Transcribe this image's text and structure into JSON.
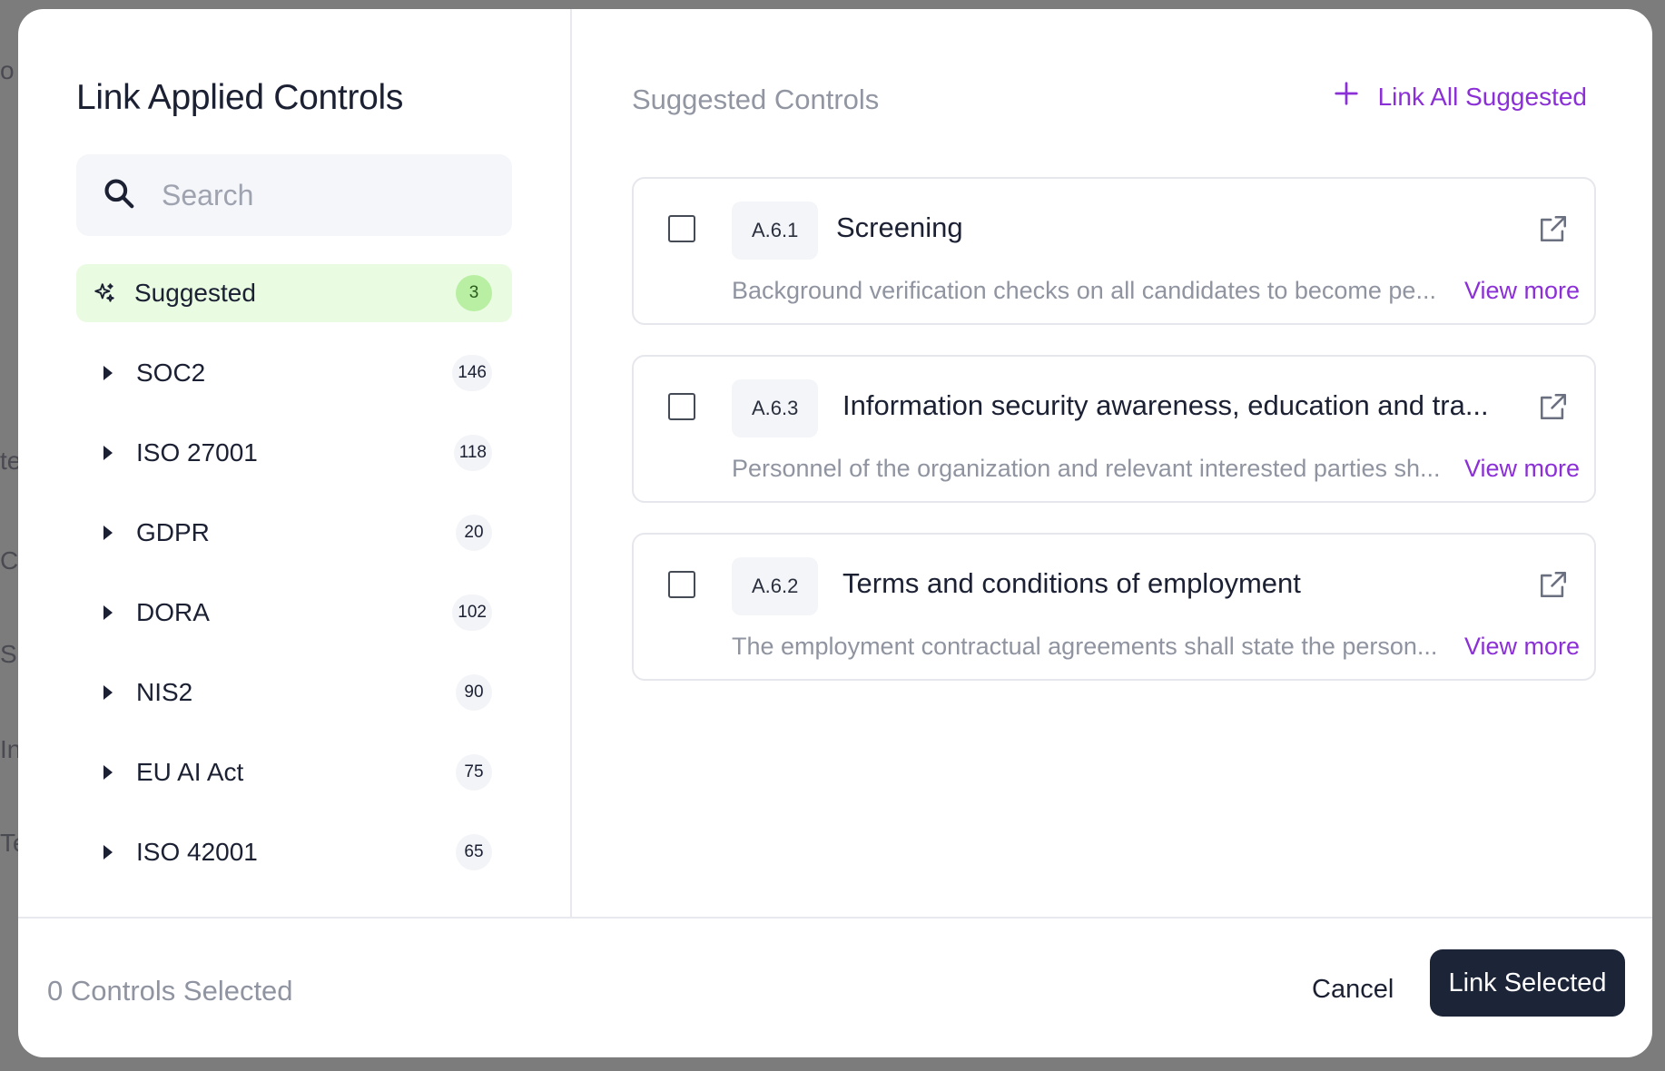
{
  "modal": {
    "title": "Link Applied Controls",
    "search": {
      "placeholder": "Search",
      "value": ""
    },
    "nav": [
      {
        "label": "Suggested",
        "count": "3",
        "active": true,
        "icon": "sparkles-icon"
      },
      {
        "label": "SOC2",
        "count": "146",
        "icon": "caret-right-icon"
      },
      {
        "label": "ISO 27001",
        "count": "118",
        "icon": "caret-right-icon"
      },
      {
        "label": "GDPR",
        "count": "20",
        "icon": "caret-right-icon"
      },
      {
        "label": "DORA",
        "count": "102",
        "icon": "caret-right-icon"
      },
      {
        "label": "NIS2",
        "count": "90",
        "icon": "caret-right-icon"
      },
      {
        "label": "EU AI Act",
        "count": "75",
        "icon": "caret-right-icon"
      },
      {
        "label": "ISO 42001",
        "count": "65",
        "icon": "caret-right-icon"
      }
    ],
    "right": {
      "title": "Suggested Controls",
      "link_all_label": "Link All Suggested",
      "controls": [
        {
          "code": "A.6.1",
          "name": "Screening",
          "description": "Background verification checks on all candidates to become pe...",
          "more_label": "View more",
          "checked": false
        },
        {
          "code": "A.6.3",
          "name": "Information security awareness, education and tra...",
          "description": "Personnel of the organization and relevant interested parties sh...",
          "more_label": "View more",
          "checked": false
        },
        {
          "code": "A.6.2",
          "name": "Terms and conditions of employment",
          "description": "The employment contractual agreements shall state the person...",
          "more_label": "View more",
          "checked": false
        }
      ]
    },
    "footer": {
      "selected_text": "0 Controls Selected",
      "cancel_label": "Cancel",
      "link_selected_label": "Link Selected"
    }
  },
  "background": {
    "letters": [
      "o",
      "te",
      "C",
      "S",
      "In",
      "Te"
    ]
  },
  "colors": {
    "accent_purple": "#8b2fd6",
    "primary_dark": "#1c2438",
    "suggested_bg": "#e9fbe1",
    "suggested_badge": "#b9efa2"
  }
}
